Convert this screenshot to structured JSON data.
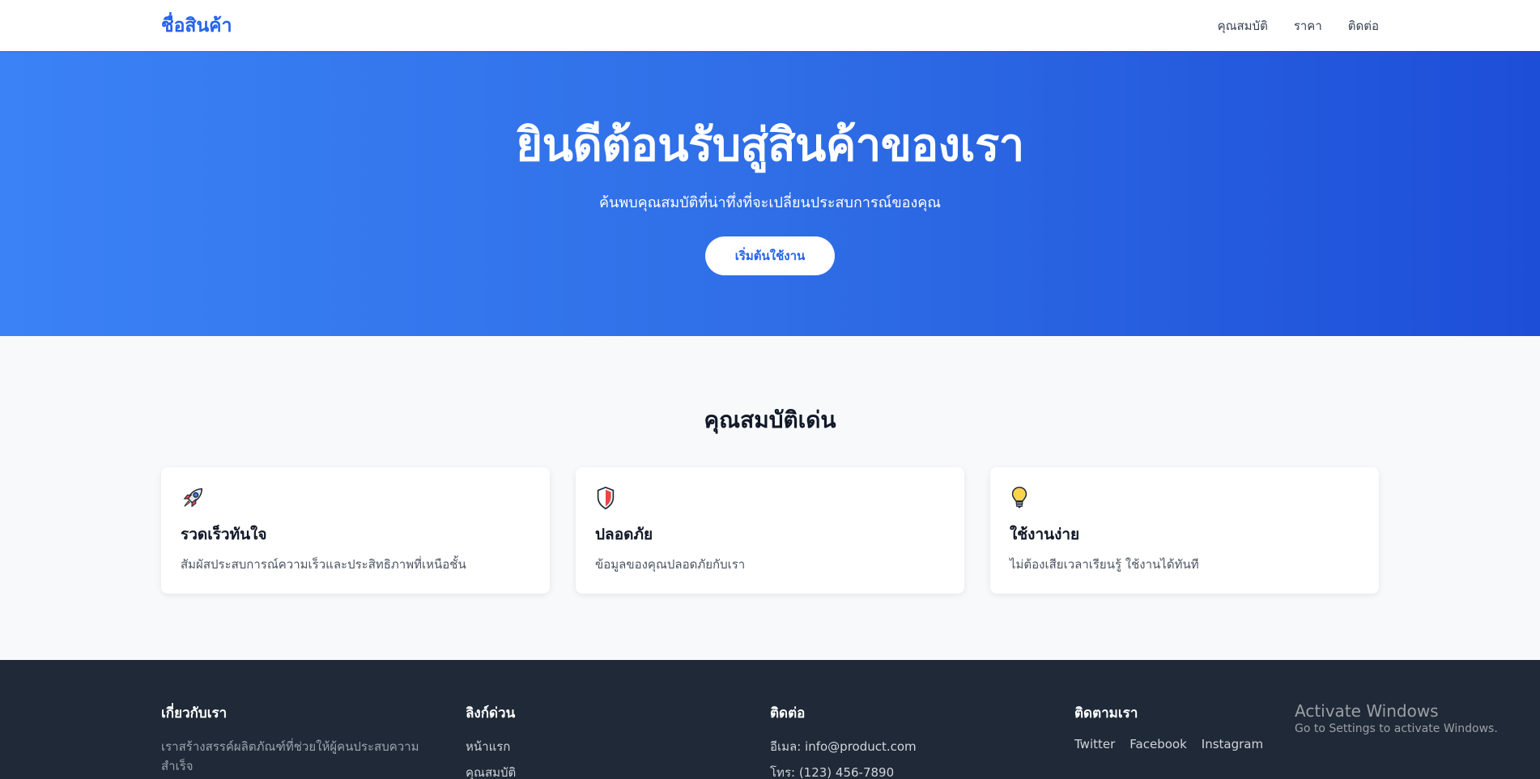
{
  "header": {
    "brand": "ชื่อสินค้า",
    "nav": [
      "คุณสมบัติ",
      "ราคา",
      "ติดต่อ"
    ]
  },
  "hero": {
    "title": "ยินดีต้อนรับสู่สินค้าของเรา",
    "subtitle": "ค้นพบคุณสมบัติที่น่าทึ่งที่จะเปลี่ยนประสบการณ์ของคุณ",
    "cta_label": "เริ่มต้นใช้งาน"
  },
  "features": {
    "title": "คุณสมบัติเด่น",
    "items": [
      {
        "icon": "rocket-icon",
        "title": "รวดเร็วทันใจ",
        "desc": "สัมผัสประสบการณ์ความเร็วและประสิทธิภาพที่เหนือชั้น"
      },
      {
        "icon": "shield-icon",
        "title": "ปลอดภัย",
        "desc": "ข้อมูลของคุณปลอดภัยกับเรา"
      },
      {
        "icon": "lightbulb-icon",
        "title": "ใช้งานง่าย",
        "desc": "ไม่ต้องเสียเวลาเรียนรู้ ใช้งานได้ทันที"
      }
    ]
  },
  "footer": {
    "about": {
      "title": "เกี่ยวกับเรา",
      "text": "เราสร้างสรรค์ผลิตภัณฑ์ที่ช่วยให้ผู้คนประสบความสำเร็จ"
    },
    "quick_links": {
      "title": "ลิงก์ด่วน",
      "items": [
        "หน้าแรก",
        "คุณสมบัติ"
      ]
    },
    "contact": {
      "title": "ติดต่อ",
      "email": "อีเมล: info@product.com",
      "phone": "โทร: (123) 456-7890"
    },
    "follow": {
      "title": "ติดตามเรา",
      "items": [
        "Twitter",
        "Facebook",
        "Instagram"
      ]
    }
  },
  "watermark": {
    "line1": "Activate Windows",
    "line2": "Go to Settings to activate Windows."
  },
  "colors": {
    "brand": "#2563eb",
    "hero_start": "#3b82f6",
    "hero_end": "#1d4ed8",
    "footer_bg": "#1f2937"
  }
}
